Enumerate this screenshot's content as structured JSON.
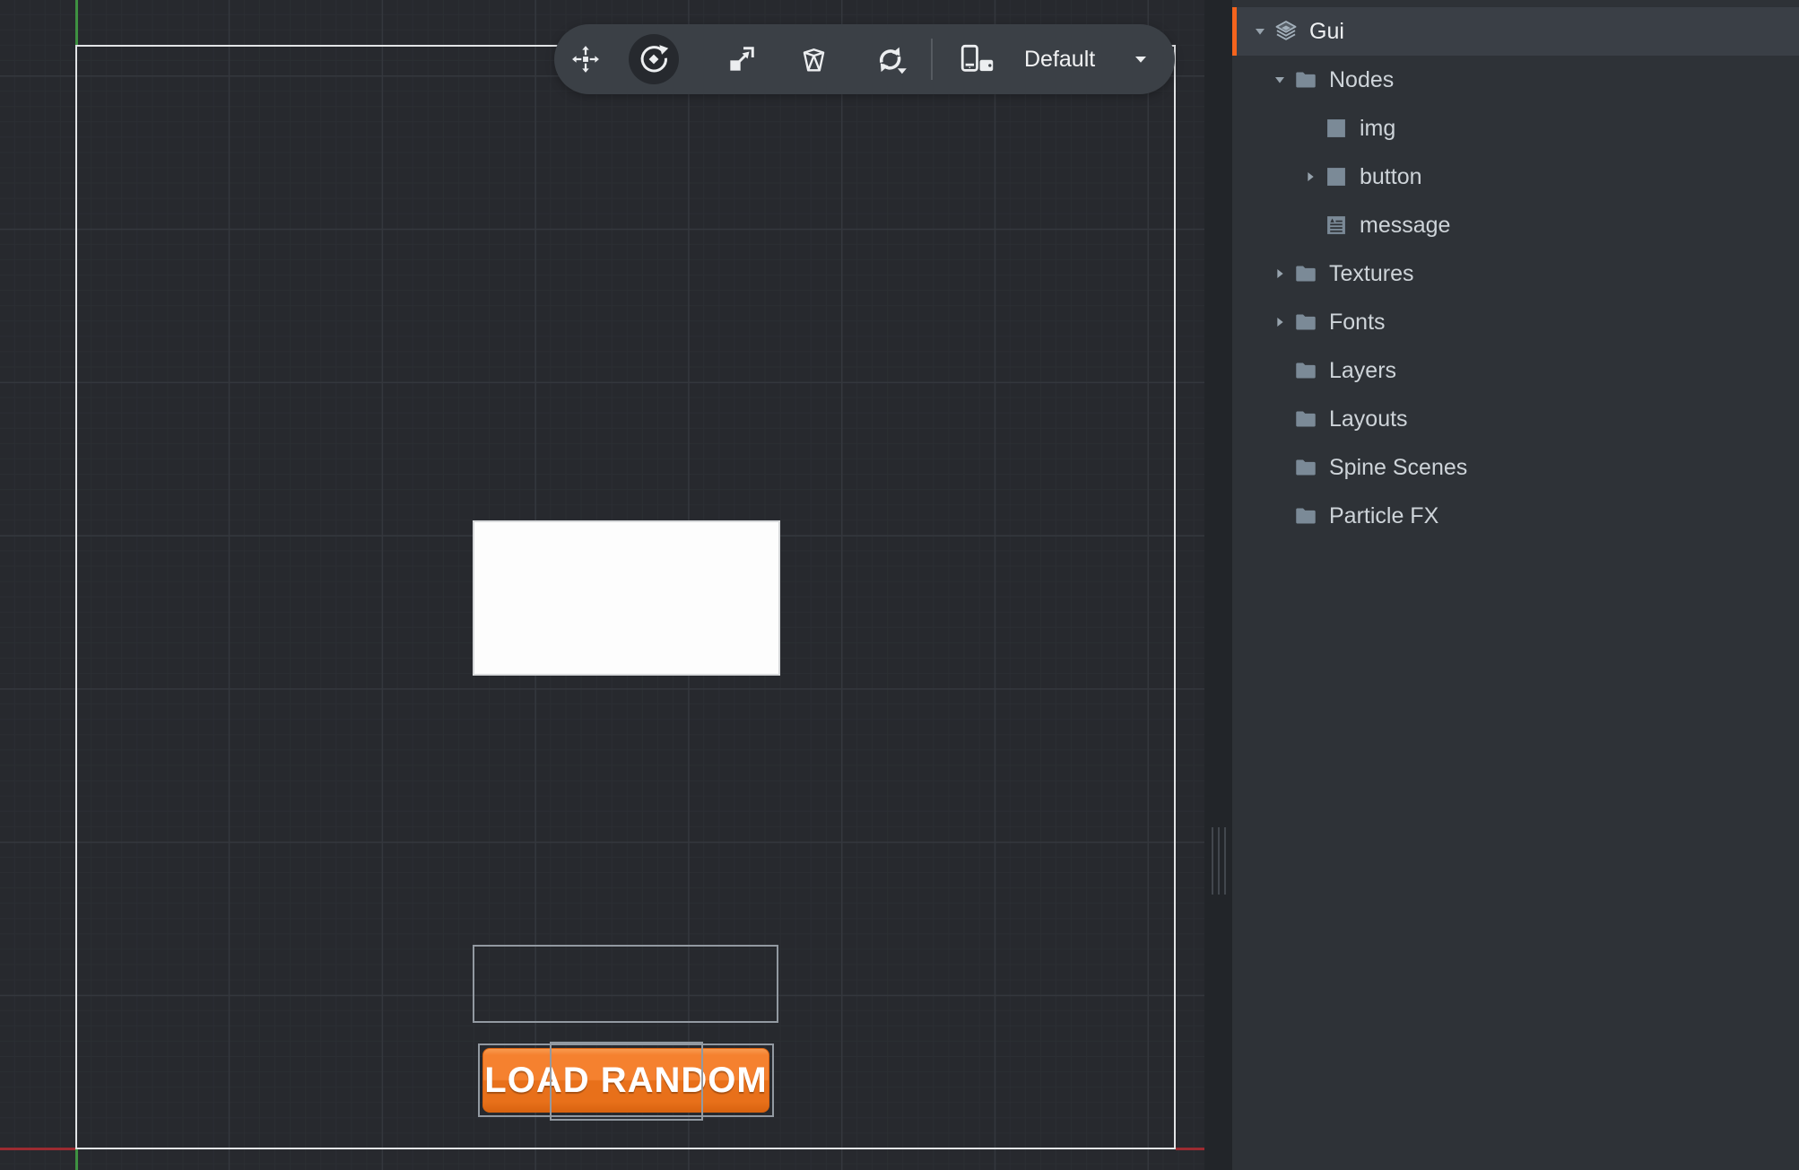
{
  "toolbar": {
    "tools": [
      {
        "name": "move",
        "active": false
      },
      {
        "name": "rotate",
        "active": true
      },
      {
        "name": "scale",
        "active": false
      },
      {
        "name": "frustum",
        "active": false
      },
      {
        "name": "camera-rotate",
        "active": false
      }
    ],
    "resolution": {
      "label": "Default"
    }
  },
  "outline_panel": {
    "selected_item": "Gui",
    "items": [
      {
        "label": "Gui",
        "icon": "gui-scene-icon",
        "level": 0,
        "expander": "expanded",
        "selected": true
      },
      {
        "label": "Nodes",
        "icon": "folder-icon",
        "level": 1,
        "expander": "expanded",
        "selected": false
      },
      {
        "label": "img",
        "icon": "box-node-icon",
        "level": 2,
        "expander": "none",
        "selected": false
      },
      {
        "label": "button",
        "icon": "box-node-icon",
        "level": 2,
        "expander": "collapsed",
        "selected": false
      },
      {
        "label": "message",
        "icon": "text-node-icon",
        "level": 2,
        "expander": "none",
        "selected": false
      },
      {
        "label": "Textures",
        "icon": "folder-icon",
        "level": 1,
        "expander": "collapsed",
        "selected": false
      },
      {
        "label": "Fonts",
        "icon": "folder-icon",
        "level": 1,
        "expander": "collapsed",
        "selected": false
      },
      {
        "label": "Layers",
        "icon": "folder-icon",
        "level": 1,
        "expander": "none",
        "selected": false
      },
      {
        "label": "Layouts",
        "icon": "folder-icon",
        "level": 1,
        "expander": "none",
        "selected": false
      },
      {
        "label": "Spine Scenes",
        "icon": "folder-icon",
        "level": 1,
        "expander": "none",
        "selected": false
      },
      {
        "label": "Particle FX",
        "icon": "folder-icon",
        "level": 1,
        "expander": "none",
        "selected": false
      }
    ]
  },
  "canvas": {
    "button_label": "LOAD RANDOM"
  },
  "colors": {
    "canvas_bg": "#27292e",
    "grid_major": "#34373d",
    "grid_minor": "#2b2e33",
    "bounds_border": "#e2e4e6",
    "axis_green": "#3e9141",
    "axis_red": "#9c2b31",
    "toolbar_bg": "#3b4046",
    "toolbar_active_bg": "#26292e",
    "icon_light": "#eceef0",
    "divider_bg": "#222529",
    "grip_line": "#42474d",
    "panel_bg": "#2e3237",
    "row_selected_bg": "#3a3f46",
    "accent_orange": "#f4641d",
    "tree_text": "#ced4d9",
    "tree_text_selected": "#eef0f2",
    "tree_icon": "#7b8a97",
    "selection_outline": "#9299a1",
    "node_white": "#fdfdfd",
    "button_orange_hilite": "#f89a50",
    "button_orange_top": "#f5812f",
    "button_orange_bottom": "#e8701a",
    "button_orange_dark": "#d96310",
    "button_text": "#ffffff"
  }
}
